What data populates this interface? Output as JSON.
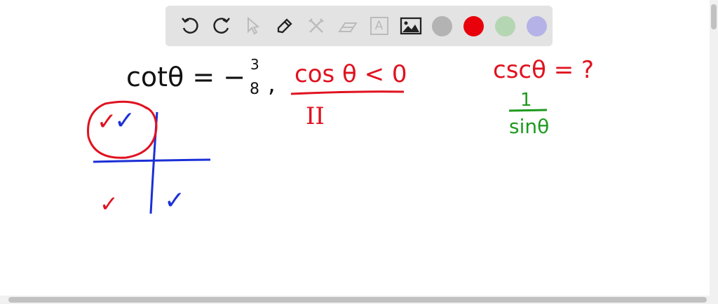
{
  "toolbar": {
    "tools": [
      "undo-icon",
      "redo-icon",
      "select-icon",
      "pen-icon",
      "tools-icon",
      "eraser-icon",
      "text-icon",
      "image-icon"
    ],
    "colors": [
      "#b3b3b3",
      "#e8000b",
      "#b5d6b2",
      "#b4b2e6"
    ],
    "text_tool_glyph": "A"
  },
  "board": {
    "equation1": "cotθ = −",
    "fraction_num": "3",
    "fraction_den": "8",
    "comma": ",",
    "condition": "cos θ < 0",
    "quadrant": "II",
    "question": "cscθ = ?",
    "reciprocal_num": "1",
    "reciprocal_den": "sinθ",
    "check": "✓"
  },
  "ink_colors": {
    "black": "#111111",
    "red": "#e0121f",
    "green": "#1d9a1d",
    "blue": "#1b2fd6"
  }
}
